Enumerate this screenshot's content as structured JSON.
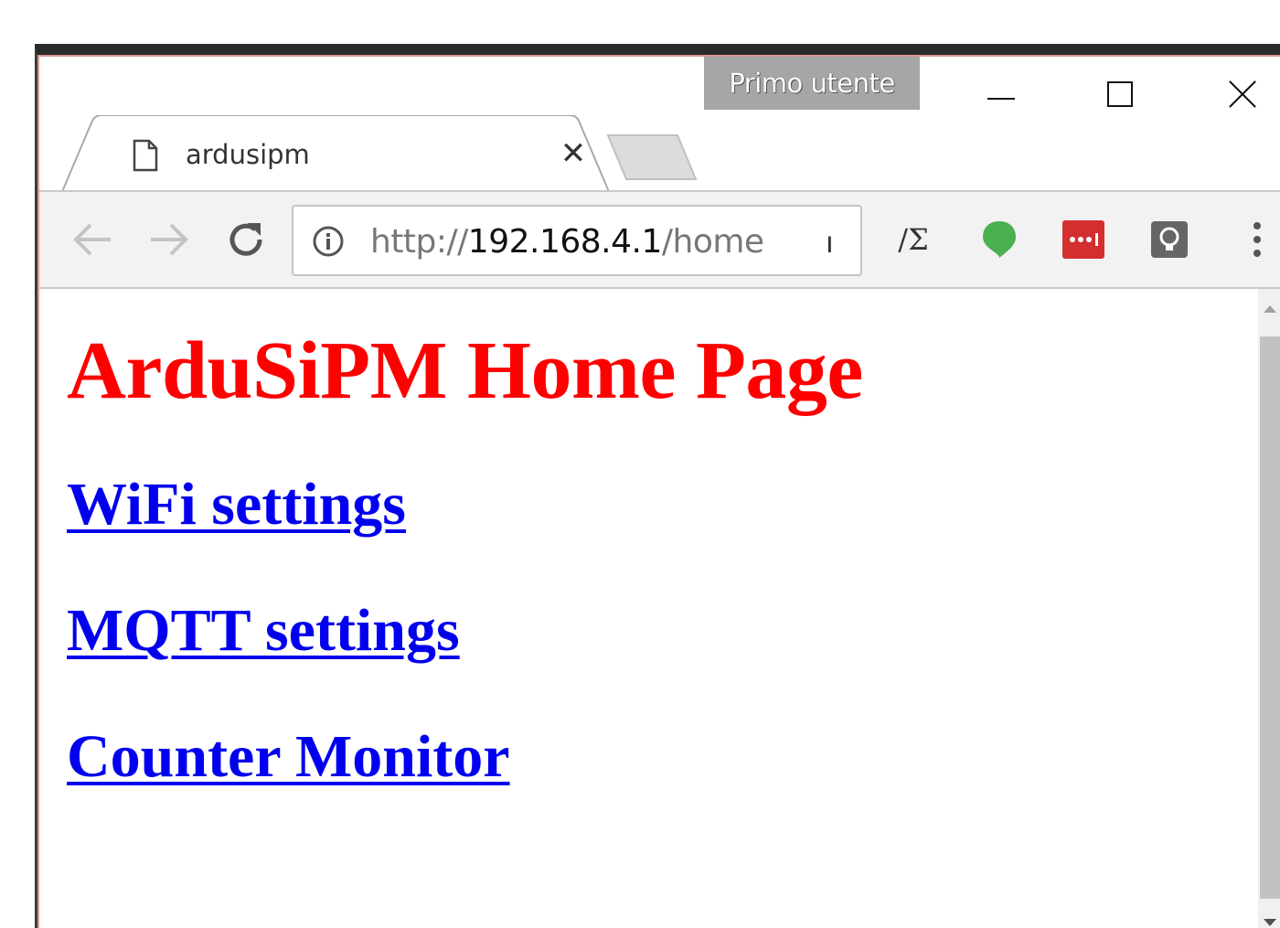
{
  "window": {
    "profile_name": "Primo utente"
  },
  "tab": {
    "title": "ardusipm",
    "close_glyph": "✕"
  },
  "toolbar": {
    "url_scheme": "http://",
    "url_host": "192.168.4.1",
    "url_path": "/home",
    "url_hint": "ו",
    "extension_sigma": "/Σ"
  },
  "icons": {
    "back": "back-arrow-icon",
    "forward": "forward-arrow-icon",
    "reload": "reload-icon",
    "info": "info-icon",
    "menu": "kebab-menu-icon"
  },
  "colors": {
    "heading": "#ff0000",
    "link": "#0000ee",
    "profile_badge": "#a6a6a6",
    "ext_green": "#4caf50",
    "ext_red": "#d32f2f"
  },
  "page": {
    "heading": "ArduSiPM Home Page",
    "links": [
      {
        "label": "WiFi settings"
      },
      {
        "label": "MQTT settings"
      },
      {
        "label": "Counter Monitor"
      }
    ]
  }
}
